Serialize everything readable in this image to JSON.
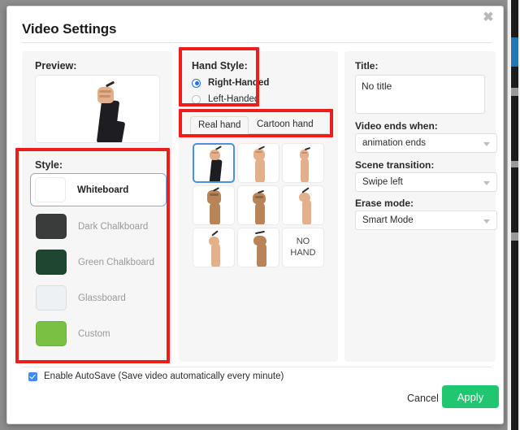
{
  "window": {
    "title": "Video Settings",
    "close_icon": "close-icon"
  },
  "preview": {
    "label": "Preview:"
  },
  "style": {
    "label": "Style:",
    "options": [
      {
        "name": "Whiteboard",
        "color": "#ffffff",
        "selected": true
      },
      {
        "name": "Dark Chalkboard",
        "color": "#3a3c3b",
        "selected": false
      },
      {
        "name": "Green Chalkboard",
        "color": "#1e4630",
        "selected": false
      },
      {
        "name": "Glassboard",
        "color": "#eef1f3",
        "selected": false
      },
      {
        "name": "Custom",
        "color": "#7ac143",
        "selected": false
      }
    ]
  },
  "hand_style": {
    "label": "Hand Style:",
    "options": [
      {
        "label": "Right-Handed",
        "selected": true
      },
      {
        "label": "Left-Handed",
        "selected": false
      }
    ],
    "tabs": [
      {
        "label": "Real hand",
        "active": true
      },
      {
        "label": "Cartoon hand",
        "active": false
      }
    ],
    "thumbnails": [
      {
        "id": "hand-1",
        "selected": true,
        "no_hand": false
      },
      {
        "id": "hand-2",
        "selected": false,
        "no_hand": false
      },
      {
        "id": "hand-3",
        "selected": false,
        "no_hand": false
      },
      {
        "id": "hand-4",
        "selected": false,
        "no_hand": false
      },
      {
        "id": "hand-5",
        "selected": false,
        "no_hand": false
      },
      {
        "id": "hand-6",
        "selected": false,
        "no_hand": false
      },
      {
        "id": "hand-7",
        "selected": false,
        "no_hand": false
      },
      {
        "id": "hand-8",
        "selected": false,
        "no_hand": false
      },
      {
        "id": "no-hand",
        "selected": false,
        "no_hand": true,
        "label": "NO\nHAND"
      }
    ],
    "no_hand_line1": "NO",
    "no_hand_line2": "HAND"
  },
  "settings": {
    "title_label": "Title:",
    "title_value": "No title",
    "title_placeholder": "No title",
    "video_ends_label": "Video ends when:",
    "video_ends_value": "animation ends",
    "scene_transition_label": "Scene transition:",
    "scene_transition_value": "Swipe left",
    "erase_mode_label": "Erase mode:",
    "erase_mode_value": "Smart Mode"
  },
  "footer": {
    "autosave_label": "Enable AutoSave (Save video automatically every minute)",
    "autosave_checked": true,
    "cancel_label": "Cancel",
    "apply_label": "Apply"
  },
  "colors": {
    "accent_green": "#21c770",
    "accent_blue": "#4a90e2",
    "annotation_red": "#ee1c1c"
  }
}
